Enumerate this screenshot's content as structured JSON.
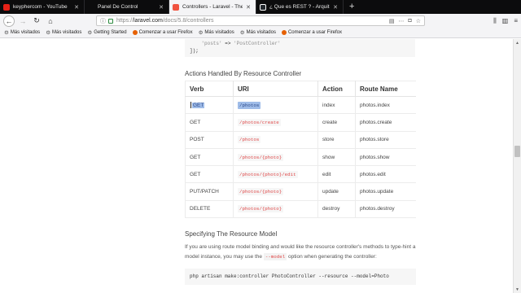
{
  "browser": {
    "tabs": [
      {
        "favicon": "youtube-icon",
        "label": "keyphercom - YouTube",
        "active": false
      },
      {
        "favicon": "none",
        "label": "Panel De Control",
        "active": false
      },
      {
        "favicon": "laravel-icon",
        "label": "Controllers - Laravel - The PHP",
        "active": true
      },
      {
        "favicon": "github-icon",
        "label": "¿ Que es REST ? - Arquitectura",
        "active": false
      }
    ],
    "new_tab": "+",
    "url_prefix": "https://",
    "url_domain": "laravel.com",
    "url_path": "/docs/5.8/controllers",
    "search_placeholder": "",
    "bookmarks": [
      {
        "icon": "gear-icon",
        "label": "Más visitados"
      },
      {
        "icon": "gear-icon",
        "label": "Más visitados"
      },
      {
        "icon": "gear-icon",
        "label": "Getting Started"
      },
      {
        "icon": "firefox-icon",
        "label": "Comenzar a usar Firefox"
      },
      {
        "icon": "gear-icon",
        "label": "Más visitados"
      },
      {
        "icon": "gear-icon",
        "label": "Más visitados"
      },
      {
        "icon": "firefox-icon",
        "label": "Comenzar a usar Firefox"
      }
    ]
  },
  "page": {
    "code_preview": {
      "line1_key": "'posts'",
      "line1_arrow": "=>",
      "line1_value": "'PostController'",
      "line2": "]);"
    },
    "section_title": "Actions Handled By Resource Controller",
    "table": {
      "headers": [
        "Verb",
        "URI",
        "Action",
        "Route Name"
      ],
      "rows": [
        {
          "verb": "GET",
          "uri": "/photos",
          "action": "index",
          "route": "photos.index"
        },
        {
          "verb": "GET",
          "uri": "/photos/create",
          "action": "create",
          "route": "photos.create"
        },
        {
          "verb": "POST",
          "uri": "/photos",
          "action": "store",
          "route": "photos.store"
        },
        {
          "verb": "GET",
          "uri": "/photos/{photo}",
          "action": "show",
          "route": "photos.show"
        },
        {
          "verb": "GET",
          "uri": "/photos/{photo}/edit",
          "action": "edit",
          "route": "photos.edit"
        },
        {
          "verb": "PUT/PATCH",
          "uri": "/photos/{photo}",
          "action": "update",
          "route": "photos.update"
        },
        {
          "verb": "DELETE",
          "uri": "/photos/{photo}",
          "action": "destroy",
          "route": "photos.destroy"
        }
      ]
    },
    "subheading": "Specifying The Resource Model",
    "paragraph_part1": "If you are using route model binding and would like the resource controller's methods to type-hint a model instance, you may use the",
    "paragraph_code": "--model",
    "paragraph_part2": "option when generating the controller:",
    "command": "php artisan make:controller PhotoController --resource --model=Photo"
  },
  "colors": {
    "tabstrip_bg": "#0c0c0d",
    "active_tab_bg": "#f4f4f6",
    "uri_red": "#e04848",
    "selection": "#9fbce8"
  }
}
